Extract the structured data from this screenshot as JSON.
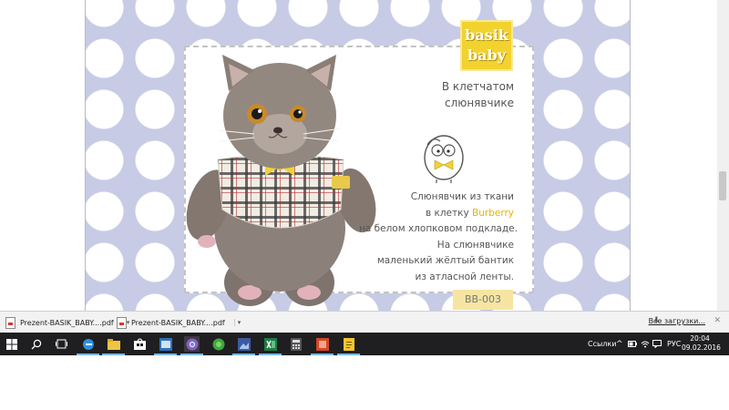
{
  "pdf_page": {
    "logo_text": "basik\nbaby",
    "title": "В клетчатом\nслюнявчике",
    "description": {
      "line1": "Слюнявчик из ткани",
      "line2_prefix": "в клетку ",
      "line2_brand": "Burberry",
      "line3": "на белом хлопковом подкладе.",
      "line4": "На слюнявчике",
      "line5": "маленький жёлтый бантик",
      "line6": "из атласной ленты."
    },
    "product_code": "BB-003"
  },
  "downloads": {
    "items": [
      {
        "label": "Prezent-BASIK_BABY....pdf"
      },
      {
        "label": "Prezent-BASIK_BABY....pdf"
      }
    ],
    "all_downloads": "Все загрузки...",
    "close_glyph": "✕"
  },
  "taskbar": {
    "icons": [
      "windows-start-icon",
      "search-icon",
      "task-view-icon",
      "edge-icon",
      "file-explorer-icon",
      "store-icon",
      "photos-icon",
      "chrome-icon",
      "green-app-icon",
      "image-viewer-icon",
      "excel-icon",
      "calculator-icon",
      "powerpoint-icon",
      "document-app-icon"
    ],
    "links_label": "Ссылки",
    "language": "РУС",
    "time": "20:04",
    "date": "09.02.2016"
  },
  "colors": {
    "polka_bg": "#c7cbe5",
    "logo_yellow": "#f2d22f",
    "brand_yellow": "#e8b500",
    "taskbar_bg": "#1f1f22"
  }
}
